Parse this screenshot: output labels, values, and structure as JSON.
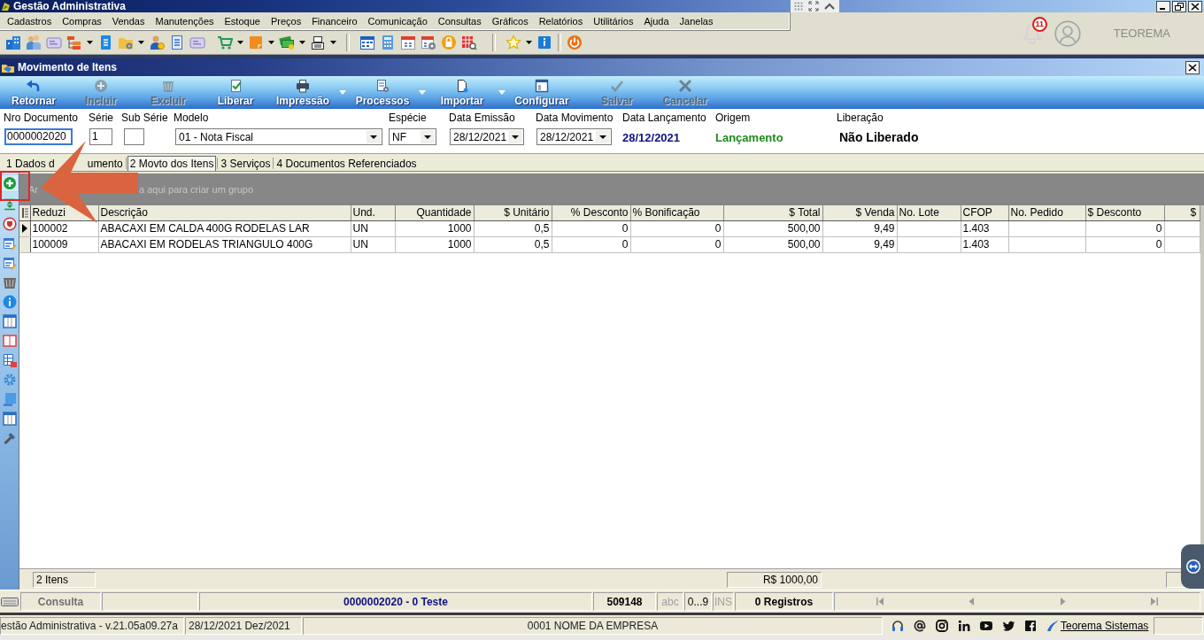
{
  "app_window": {
    "title": "Gestão Administrativa"
  },
  "menu": [
    "Cadastros",
    "Compras",
    "Vendas",
    "Manutenções",
    "Estoque",
    "Preços",
    "Financeiro",
    "Comunicação",
    "Consultas",
    "Gráficos",
    "Relatórios",
    "Utilitários",
    "Ajuda",
    "Janelas"
  ],
  "notifications": {
    "count": "11"
  },
  "account": {
    "name": "TEOREMA"
  },
  "document_window": {
    "title": "Movimento de Itens"
  },
  "actions": [
    {
      "label": "Retornar",
      "disabled": false,
      "has_menu": false
    },
    {
      "label": "Incluir",
      "disabled": true,
      "has_menu": false
    },
    {
      "label": "Excluir",
      "disabled": true,
      "has_menu": false
    },
    {
      "label": "Liberar",
      "disabled": false,
      "has_menu": false
    },
    {
      "label": "Impressão",
      "disabled": false,
      "has_menu": true
    },
    {
      "label": "Processos",
      "disabled": false,
      "has_menu": true
    },
    {
      "label": "Importar",
      "disabled": false,
      "has_menu": true
    },
    {
      "label": "Configurar",
      "disabled": false,
      "has_menu": false
    },
    {
      "label": "Salvar",
      "disabled": true,
      "has_menu": false
    },
    {
      "label": "Cancelar",
      "disabled": true,
      "has_menu": false
    }
  ],
  "form": [
    {
      "kind": "input",
      "label": "Nro Documento",
      "value": "0000002020",
      "focused": true
    },
    {
      "kind": "input",
      "label": "Série",
      "value": "1",
      "focused": false
    },
    {
      "kind": "input",
      "label": "Sub Série",
      "focused": false
    },
    {
      "kind": "select",
      "label": "Modelo",
      "value": "01 - Nota Fiscal",
      "focused": false
    },
    {
      "kind": "select",
      "label": "Espécie",
      "value": "NF",
      "focused": false
    },
    {
      "kind": "select",
      "label": "Data Emissão",
      "value": "28/12/2021",
      "focused": false
    },
    {
      "kind": "select",
      "label": "Data Movimento",
      "value": "28/12/2021",
      "focused": false
    },
    {
      "kind": "display",
      "label": "Data Lançamento",
      "value": "28/12/2021",
      "color": "#101080"
    },
    {
      "kind": "display",
      "label": "Origem",
      "value": "Lançamento",
      "color": "#1a8a1a"
    },
    {
      "kind": "display",
      "label": "Liberação",
      "value": "Não Liberado",
      "color": "#000000"
    }
  ],
  "tabs": [
    {
      "label_parts": [
        "1 Dados d",
        "umento"
      ],
      "selected": false
    },
    {
      "label_parts": [
        "2 Movto dos Itens"
      ],
      "selected": true
    },
    {
      "label_parts": [
        "3 Serviços"
      ],
      "selected": false
    },
    {
      "label_parts": [
        "4 Documentos Referenciados"
      ],
      "selected": false
    }
  ],
  "group_panel": {
    "hint_parts": [
      "Ar",
      "a aqui para criar um grupo"
    ]
  },
  "grid": {
    "columns": [
      "Reduzi",
      "Descrição",
      "Und.",
      "Quantidade",
      "$ Unitário",
      "% Desconto",
      "% Bonificação",
      "$ Total",
      "$ Venda",
      "No. Lote",
      "CFOP",
      "No. Pedido",
      "$ Desconto",
      "$"
    ],
    "rows": [
      {
        "current": true,
        "cells": [
          "100002",
          "ABACAXI EM CALDA 400G RODELAS LAR",
          "UN",
          "1000",
          "0,5",
          "0",
          "0",
          "500,00",
          "9,49",
          null,
          "1.403",
          null,
          "0",
          null
        ]
      },
      {
        "current": false,
        "cells": [
          "100009",
          "ABACAXI EM RODELAS TRIANGULO 400G",
          "UN",
          "1000",
          "0,5",
          "0",
          "0",
          "500,00",
          "9,49",
          null,
          "1.403",
          null,
          "0",
          null
        ]
      }
    ]
  },
  "grid_footer": {
    "item_count": "2 Itens",
    "total": "R$ 1000,00"
  },
  "status_bar": {
    "mode": "Consulta",
    "record": "0000002020 - 0 Teste",
    "code": "509148",
    "indicators": [
      {
        "label": "abc",
        "active": false
      },
      {
        "label": "0...9",
        "active": true
      },
      {
        "label": "INS",
        "active": false
      }
    ],
    "records": "0 Registros",
    "navigation": [
      {
        "disabled": true
      },
      {
        "disabled": true
      },
      {
        "disabled": true
      },
      {
        "disabled": true
      }
    ]
  },
  "footer": {
    "version": "estão Administrativa - v.21.05a09.27a",
    "period": "28/12/2021 Dez/2021",
    "company": "0001 NOME DA EMPRESA",
    "link": "Teorema Sistemas"
  }
}
